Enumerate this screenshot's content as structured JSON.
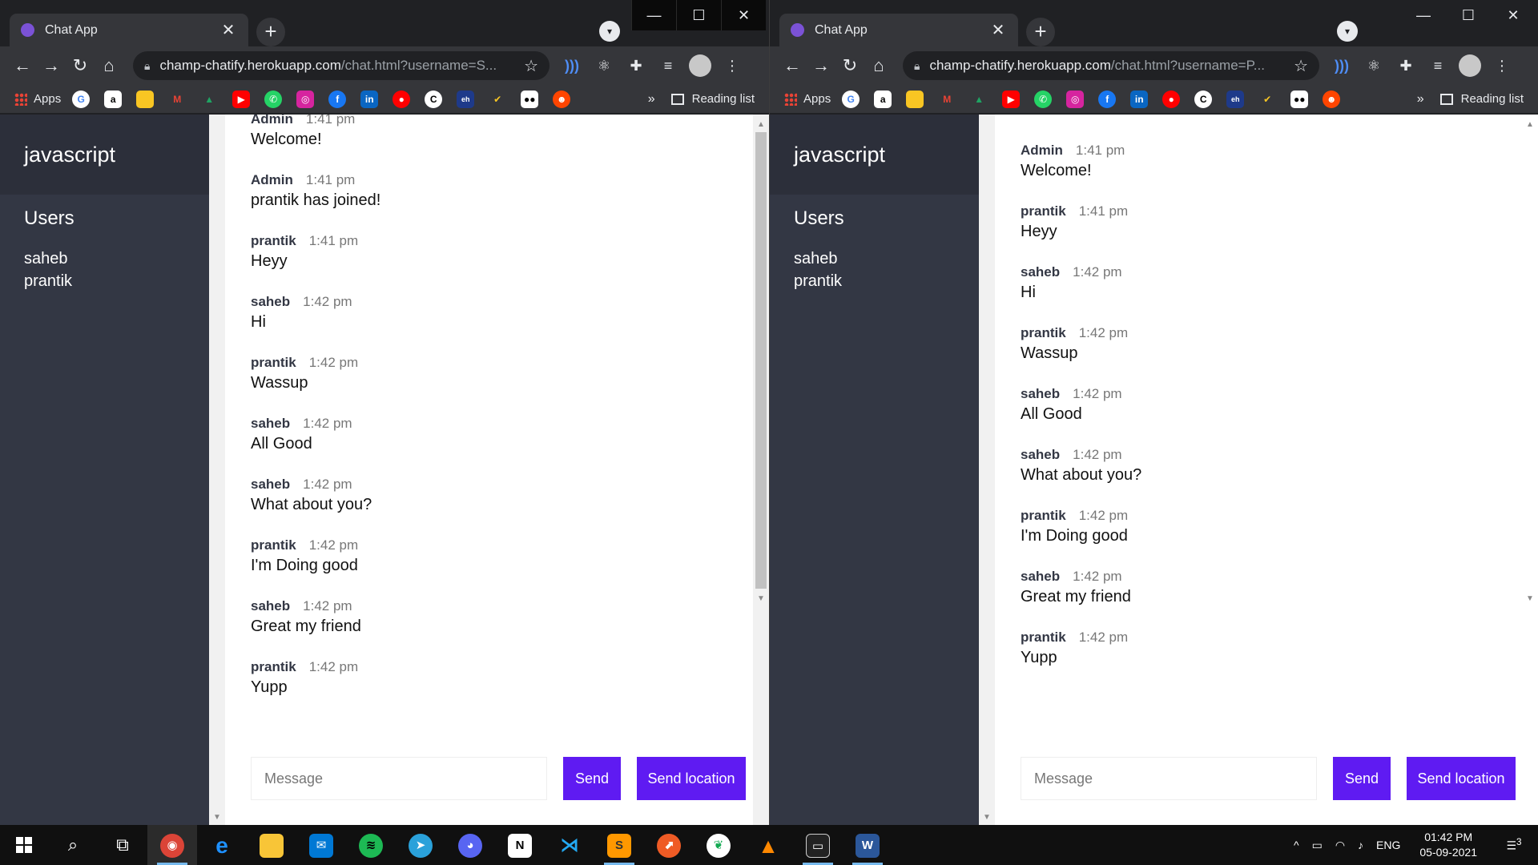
{
  "browser": {
    "tab_title": "Chat App",
    "tab_close": "✕",
    "new_tab": "+",
    "url_host": "champ-chatify.herokuapp.com",
    "left_url_path": "/chat.html?username=S...",
    "right_url_path": "/chat.html?username=P...",
    "bookmarks": {
      "apps_label": "Apps",
      "more": "»",
      "reading_list": "Reading list",
      "icons": [
        "google-icon",
        "amazon-icon",
        "keep-icon",
        "gmail-icon",
        "drive-icon",
        "youtube-icon",
        "whatsapp-icon",
        "instagram-icon",
        "facebook-icon",
        "linkedin-icon",
        "youtube-music-icon",
        "coursera-icon",
        "eh-icon",
        "todoist-icon",
        "medium-icon",
        "reddit-icon"
      ]
    },
    "window_controls": {
      "minimize": "—",
      "maximize": "☐",
      "close": "✕"
    }
  },
  "chat": {
    "room": "javascript",
    "users_title": "Users",
    "users": [
      "saheb",
      "prantik"
    ],
    "input_placeholder": "Message",
    "send_label": "Send",
    "send_location_label": "Send location"
  },
  "left_messages": [
    {
      "name": "Admin",
      "time": "1:41 pm",
      "text": "Welcome!"
    },
    {
      "name": "Admin",
      "time": "1:41 pm",
      "text": "prantik has joined!"
    },
    {
      "name": "prantik",
      "time": "1:41 pm",
      "text": "Heyy"
    },
    {
      "name": "saheb",
      "time": "1:42 pm",
      "text": "Hi"
    },
    {
      "name": "prantik",
      "time": "1:42 pm",
      "text": "Wassup"
    },
    {
      "name": "saheb",
      "time": "1:42 pm",
      "text": "All Good"
    },
    {
      "name": "saheb",
      "time": "1:42 pm",
      "text": "What about you?"
    },
    {
      "name": "prantik",
      "time": "1:42 pm",
      "text": "I'm Doing good"
    },
    {
      "name": "saheb",
      "time": "1:42 pm",
      "text": "Great my friend"
    },
    {
      "name": "prantik",
      "time": "1:42 pm",
      "text": "Yupp"
    }
  ],
  "right_messages": [
    {
      "name": "Admin",
      "time": "1:41 pm",
      "text": "Welcome!"
    },
    {
      "name": "prantik",
      "time": "1:41 pm",
      "text": "Heyy"
    },
    {
      "name": "saheb",
      "time": "1:42 pm",
      "text": "Hi"
    },
    {
      "name": "prantik",
      "time": "1:42 pm",
      "text": "Wassup"
    },
    {
      "name": "saheb",
      "time": "1:42 pm",
      "text": "All Good"
    },
    {
      "name": "saheb",
      "time": "1:42 pm",
      "text": "What about you?"
    },
    {
      "name": "prantik",
      "time": "1:42 pm",
      "text": "I'm Doing good"
    },
    {
      "name": "saheb",
      "time": "1:42 pm",
      "text": "Great my friend"
    },
    {
      "name": "prantik",
      "time": "1:42 pm",
      "text": "Yupp"
    }
  ],
  "taskbar": {
    "language": "ENG",
    "time": "01:42 PM",
    "date": "05-09-2021",
    "notification_count": "3",
    "apps": [
      "chrome-icon",
      "edge-icon",
      "file-explorer-icon",
      "mail-icon",
      "spotify-icon",
      "telegram-icon",
      "discord-icon",
      "notion-icon",
      "vscode-icon",
      "sublime-icon",
      "postman-icon",
      "mongodb-icon",
      "vlc-icon",
      "terminal-icon",
      "word-icon"
    ]
  },
  "colors": {
    "sidebar": "#333744",
    "sidebar_header": "#2c2f3a",
    "accent_button": "#5f1bf2",
    "tab_favicon": "#7b52d6"
  }
}
